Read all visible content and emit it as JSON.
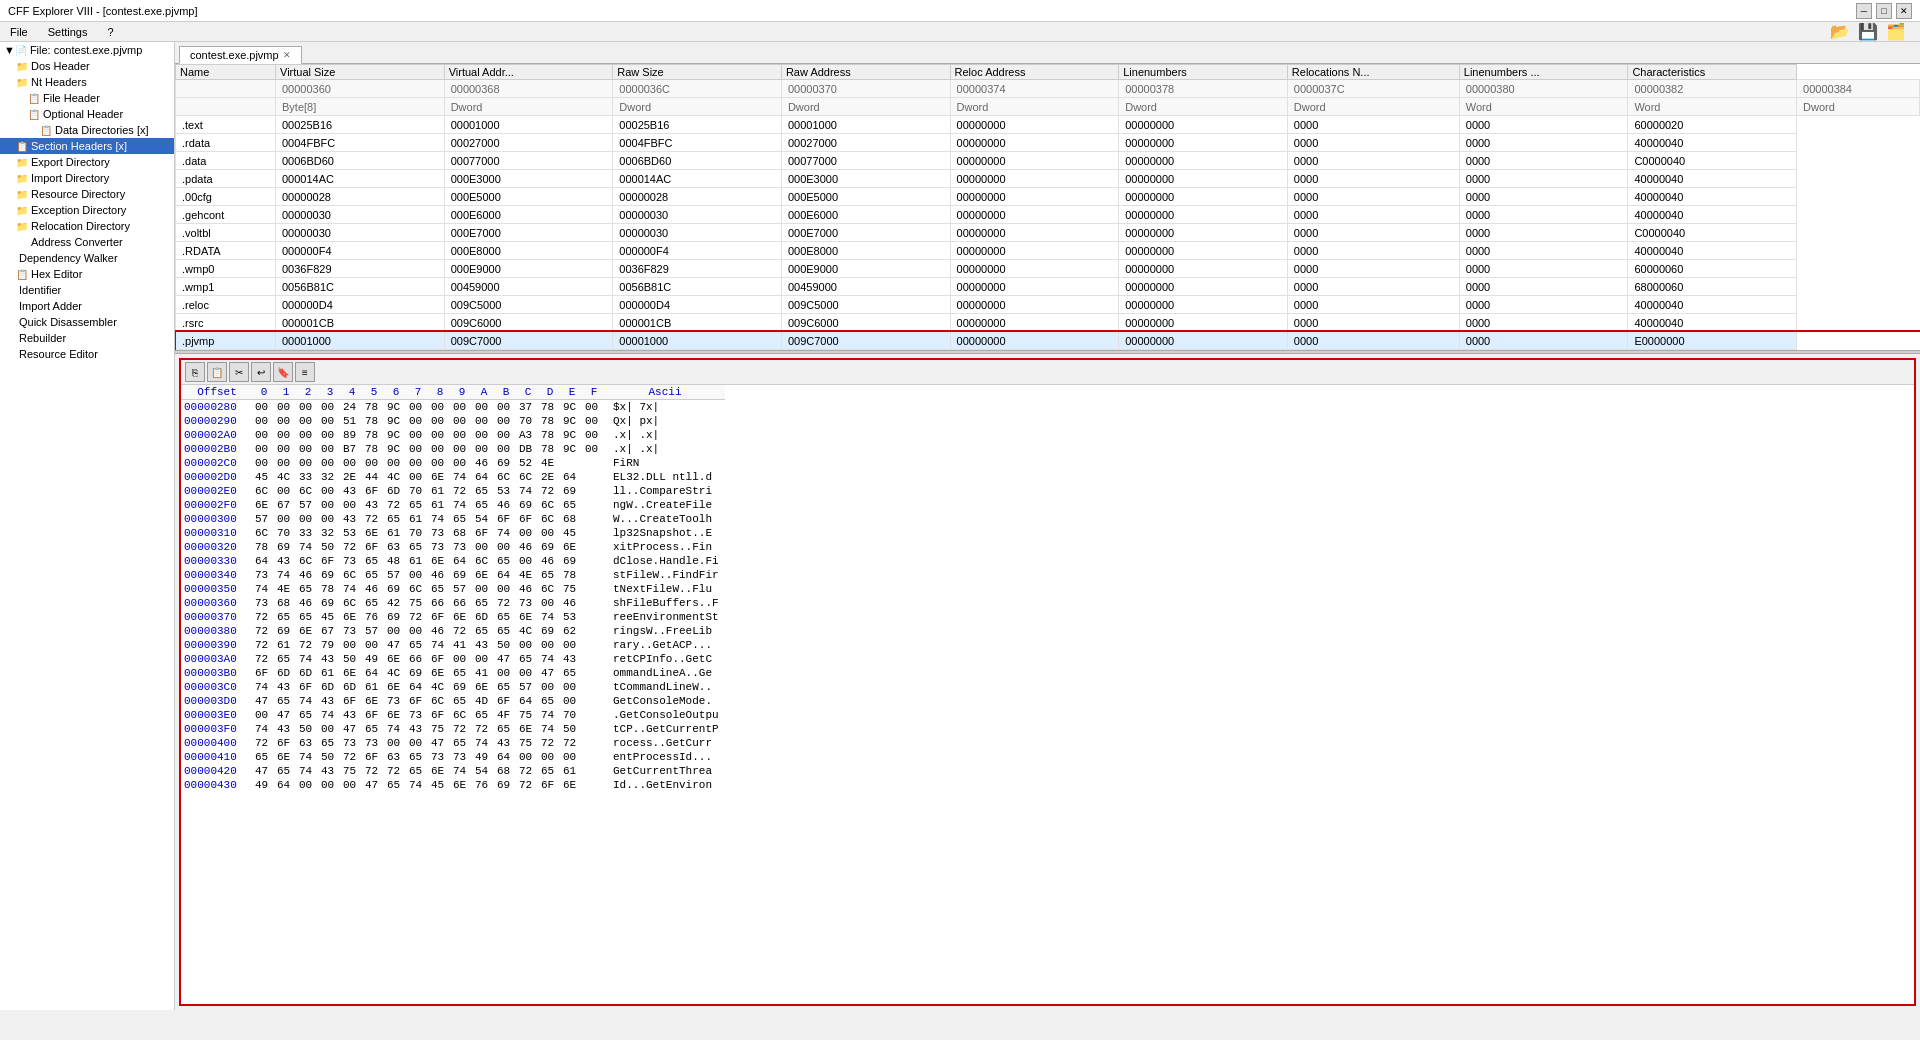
{
  "titlebar": {
    "title": "CFF Explorer VIII - [contest.exe.pjvmp]",
    "minimize": "─",
    "maximize": "□",
    "close": "✕"
  },
  "menubar": {
    "items": [
      "File",
      "Settings",
      "?"
    ]
  },
  "tab": {
    "label": "contest.exe.pjvmp",
    "close": "x"
  },
  "sidebar": {
    "items": [
      {
        "label": "File: contest.exe.pjvmp",
        "indent": 0,
        "icon": "📄",
        "selected": false
      },
      {
        "label": "Dos Header",
        "indent": 1,
        "icon": "📁",
        "selected": false
      },
      {
        "label": "Nt Headers",
        "indent": 1,
        "icon": "📁",
        "selected": false
      },
      {
        "label": "File Header",
        "indent": 2,
        "icon": "📋",
        "selected": false
      },
      {
        "label": "Optional Header",
        "indent": 2,
        "icon": "📋",
        "selected": false
      },
      {
        "label": "Data Directories [x]",
        "indent": 3,
        "icon": "📋",
        "selected": false
      },
      {
        "label": "Section Headers [x]",
        "indent": 1,
        "icon": "📋",
        "selected": true
      },
      {
        "label": "Export Directory",
        "indent": 1,
        "icon": "📁",
        "selected": false
      },
      {
        "label": "Import Directory",
        "indent": 1,
        "icon": "📁",
        "selected": false
      },
      {
        "label": "Resource Directory",
        "indent": 1,
        "icon": "📁",
        "selected": false
      },
      {
        "label": "Exception Directory",
        "indent": 1,
        "icon": "📁",
        "selected": false
      },
      {
        "label": "Relocation Directory",
        "indent": 1,
        "icon": "📁",
        "selected": false
      },
      {
        "label": "Address Converter",
        "indent": 2,
        "icon": "",
        "selected": false
      },
      {
        "label": "Dependency Walker",
        "indent": 1,
        "icon": "",
        "selected": false
      },
      {
        "label": "Hex Editor",
        "indent": 1,
        "icon": "📋",
        "selected": false
      },
      {
        "label": "Identifier",
        "indent": 1,
        "icon": "",
        "selected": false
      },
      {
        "label": "Import Adder",
        "indent": 1,
        "icon": "",
        "selected": false
      },
      {
        "label": "Quick Disassembler",
        "indent": 1,
        "icon": "",
        "selected": false
      },
      {
        "label": "Rebuilder",
        "indent": 1,
        "icon": "",
        "selected": false
      },
      {
        "label": "Resource Editor",
        "indent": 1,
        "icon": "",
        "selected": false
      }
    ]
  },
  "table": {
    "columns": [
      "Name",
      "Virtual Size",
      "Virtual Addr...",
      "Raw Size",
      "Raw Address",
      "Reloc Address",
      "Linenumbers",
      "Relocations N...",
      "Linenumbers ...",
      "Characteristics"
    ],
    "rows": [
      [
        "",
        "00000360",
        "00000368",
        "0000036C",
        "00000370",
        "00000374",
        "00000378",
        "0000037C",
        "00000380",
        "00000382",
        "00000384"
      ],
      [
        "",
        "Byte[8]",
        "Dword",
        "Dword",
        "Dword",
        "Dword",
        "Dword",
        "Dword",
        "Word",
        "Word",
        "Dword"
      ],
      [
        ".text",
        "00025B16",
        "00001000",
        "00025B16",
        "00001000",
        "00000000",
        "00000000",
        "0000",
        "0000",
        "60000020"
      ],
      [
        ".rdata",
        "0004FBFC",
        "00027000",
        "0004FBFC",
        "00027000",
        "00000000",
        "00000000",
        "0000",
        "0000",
        "40000040"
      ],
      [
        ".data",
        "0006BD60",
        "00077000",
        "0006BD60",
        "00077000",
        "00000000",
        "00000000",
        "0000",
        "0000",
        "C0000040"
      ],
      [
        ".pdata",
        "000014AC",
        "000E3000",
        "000014AC",
        "000E3000",
        "00000000",
        "00000000",
        "0000",
        "0000",
        "40000040"
      ],
      [
        ".00cfg",
        "00000028",
        "000E5000",
        "00000028",
        "000E5000",
        "00000000",
        "00000000",
        "0000",
        "0000",
        "40000040"
      ],
      [
        ".gehcont",
        "00000030",
        "000E6000",
        "00000030",
        "000E6000",
        "00000000",
        "00000000",
        "0000",
        "0000",
        "40000040"
      ],
      [
        ".voltbl",
        "00000030",
        "000E7000",
        "00000030",
        "000E7000",
        "00000000",
        "00000000",
        "0000",
        "0000",
        "C0000040"
      ],
      [
        ".RDATA",
        "000000F4",
        "000E8000",
        "000000F4",
        "000E8000",
        "00000000",
        "00000000",
        "0000",
        "0000",
        "40000040"
      ],
      [
        ".wmp0",
        "0036F829",
        "000E9000",
        "0036F829",
        "000E9000",
        "00000000",
        "00000000",
        "0000",
        "0000",
        "60000060"
      ],
      [
        ".wmp1",
        "0056B81C",
        "00459000",
        "0056B81C",
        "00459000",
        "00000000",
        "00000000",
        "0000",
        "0000",
        "68000060"
      ],
      [
        ".reloc",
        "000000D4",
        "009C5000",
        "000000D4",
        "009C5000",
        "00000000",
        "00000000",
        "0000",
        "0000",
        "40000040"
      ],
      [
        ".rsrc",
        "000001CB",
        "009C6000",
        "000001CB",
        "009C6000",
        "00000000",
        "00000000",
        "0000",
        "0000",
        "40000040"
      ],
      [
        ".pjvmp",
        "00001000",
        "009C7000",
        "00001000",
        "009C7000",
        "00000000",
        "00000000",
        "0000",
        "0000",
        "E0000000"
      ]
    ],
    "selected_row": 14
  },
  "hex": {
    "toolbar_icons": [
      "copy",
      "paste",
      "cut",
      "undo",
      "bookmark",
      "settings"
    ],
    "headers": [
      "Offset",
      "0",
      "1",
      "2",
      "3",
      "4",
      "5",
      "6",
      "7",
      "8",
      "9",
      "A",
      "B",
      "C",
      "D",
      "E",
      "F",
      "Ascii"
    ],
    "rows": [
      {
        "offset": "00000280",
        "bytes": "00 00 00 00 24 78 9C 00 00 00 00 00 37 78 9C 00",
        "ascii": "  $x|    7x|"
      },
      {
        "offset": "00000290",
        "bytes": "00 00 00 00 51 78 9C 00 00 00 00 00 70 78 9C 00",
        "ascii": "  Qx|    px|"
      },
      {
        "offset": "000002A0",
        "bytes": "00 00 00 00 89 78 9C 00 00 00 00 00 A3 78 9C 00",
        "ascii": "  .x|    .x|"
      },
      {
        "offset": "000002B0",
        "bytes": "00 00 00 00 B7 78 9C 00 00 00 00 00 DB 78 9C 00",
        "ascii": "  .x|    .x|"
      },
      {
        "offset": "000002C0",
        "bytes": "00 00 00 00 00 00 00 00 00 00 46 69 52 4E",
        "ascii": "        FiRN"
      },
      {
        "offset": "000002D0",
        "bytes": "45 4C 33 32 2E 44 4C 00 6E 74 64 6C 6C 2E 64",
        "ascii": "EL32.DLL ntll.d"
      },
      {
        "offset": "000002E0",
        "bytes": "6C 00 6C 00 43 6F 6D 70 61 72 65 53 74 72 69",
        "ascii": "ll..CompareStri"
      },
      {
        "offset": "000002F0",
        "bytes": "6E 67 57 00 00 43 72 65 61 74 65 46 69 6C 65",
        "ascii": "ngW..CreateFile"
      },
      {
        "offset": "00000300",
        "bytes": "57 00 00 00 43 72 65 61 74 65 54 6F 6F 6C 68",
        "ascii": "W...CreateToolh"
      },
      {
        "offset": "00000310",
        "bytes": "6C 70 33 32 53 6E 61 70 73 68 6F 74 00 00 45",
        "ascii": "lp32Snapshot..E"
      },
      {
        "offset": "00000320",
        "bytes": "78 69 74 50 72 6F 63 65 73 73 00 00 46 69 6E",
        "ascii": "xitProcess..Fin"
      },
      {
        "offset": "00000330",
        "bytes": "64 43 6C 6F 73 65 48 61 6E 64 6C 65 00 46 69",
        "ascii": "dClose.Handle.Fi"
      },
      {
        "offset": "00000340",
        "bytes": "73 74 46 69 6C 65 57 00 46 69 6E 64 4E 65 78",
        "ascii": "stFileW..FindFir"
      },
      {
        "offset": "00000350",
        "bytes": "74 4E 65 78 74 46 69 6C 65 57 00 00 46 6C 75",
        "ascii": "tNextFileW..Flu"
      },
      {
        "offset": "00000360",
        "bytes": "73 68 46 69 6C 65 42 75 66 66 65 72 73 00 46",
        "ascii": "shFileBuffers..F"
      },
      {
        "offset": "00000370",
        "bytes": "72 65 65 45 6E 76 69 72 6F 6E 6D 65 6E 74 53",
        "ascii": "reeEnvironmentSt"
      },
      {
        "offset": "00000380",
        "bytes": "72 69 6E 67 73 57 00 00 46 72 65 65 4C 69 62",
        "ascii": "ringsW..FreeLib"
      },
      {
        "offset": "00000390",
        "bytes": "72 61 72 79 00 00 47 65 74 41 43 50 00 00 00",
        "ascii": "rary..GetACP..."
      },
      {
        "offset": "000003A0",
        "bytes": "72 65 74 43 50 49 6E 66 6F 00 00 47 65 74 43",
        "ascii": "retCPInfo..GetC"
      },
      {
        "offset": "000003B0",
        "bytes": "6F 6D 6D 61 6E 64 4C 69 6E 65 41 00 00 47 65",
        "ascii": "ommandLineA..Ge"
      },
      {
        "offset": "000003C0",
        "bytes": "74 43 6F 6D 6D 61 6E 64 4C 69 6E 65 57 00 00",
        "ascii": "tCommandLineW.."
      },
      {
        "offset": "000003D0",
        "bytes": "47 65 74 43 6F 6E 73 6F 6C 65 4D 6F 64 65 00",
        "ascii": "GetConsoleMode."
      },
      {
        "offset": "000003E0",
        "bytes": "00 47 65 74 43 6F 6E 73 6F 6C 65 4F 75 74 70",
        "ascii": ".GetConsoleOutpu"
      },
      {
        "offset": "000003F0",
        "bytes": "74 43 50 00 47 65 74 43 75 72 72 65 6E 74 50",
        "ascii": "tCP..GetCurrentP"
      },
      {
        "offset": "00000400",
        "bytes": "72 6F 63 65 73 73 00 00 47 65 74 43 75 72 72",
        "ascii": "rocess..GetCurr"
      },
      {
        "offset": "00000410",
        "bytes": "65 6E 74 50 72 6F 63 65 73 73 49 64 00 00 00",
        "ascii": "entProcessId..."
      },
      {
        "offset": "00000420",
        "bytes": "47 65 74 43 75 72 72 65 6E 74 54 68 72 65 61",
        "ascii": "GetCurrentThrea"
      },
      {
        "offset": "00000430",
        "bytes": "49 64 00 00 00 47 65 74 45 6E 76 69 72 6F 6E",
        "ascii": "Id...GetEnviron"
      }
    ]
  },
  "colors": {
    "selected_blue": "#316ac5",
    "highlight_light": "#cce8ff",
    "header_bg": "#f0f0f0",
    "red_border": "#cc0000",
    "offset_color": "#0000cc",
    "value_color": "#000080"
  }
}
